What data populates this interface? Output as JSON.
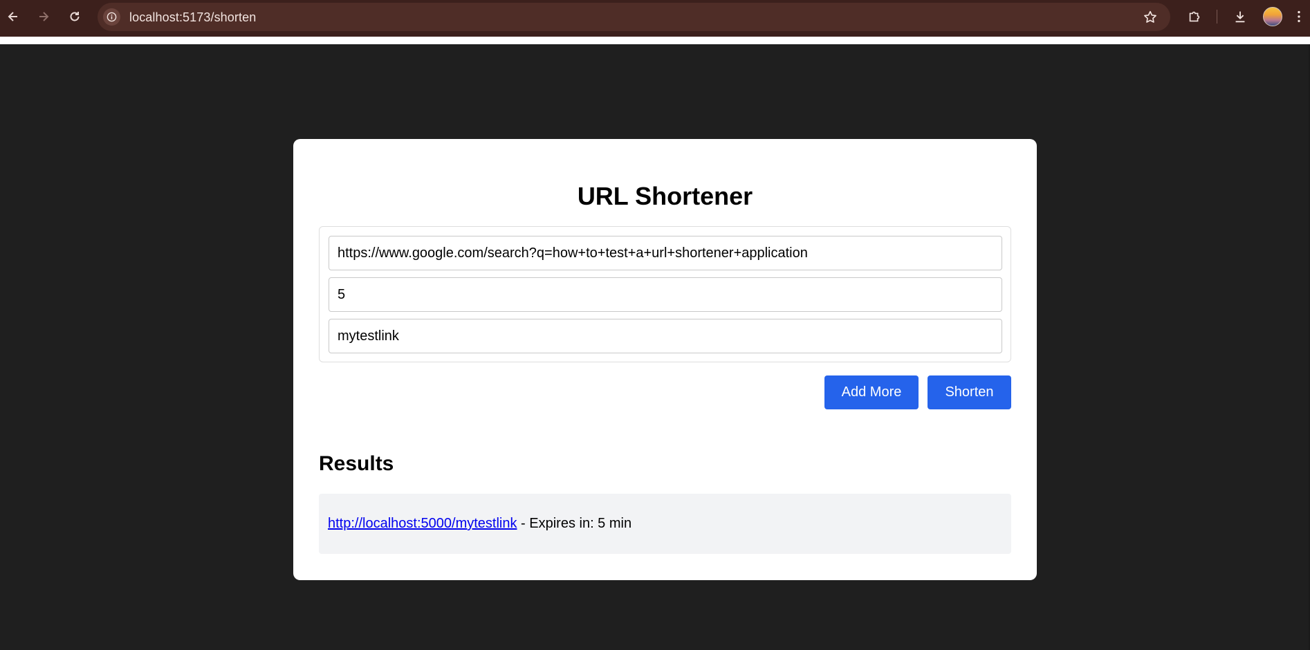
{
  "browser": {
    "url": "localhost:5173/shorten",
    "back_icon": "arrow-left-icon",
    "forward_icon": "arrow-right-icon",
    "reload_icon": "reload-icon",
    "site_info_icon": "info-icon",
    "bookmark_icon": "star-icon",
    "extensions_icon": "puzzle-icon",
    "download_icon": "download-icon",
    "menu_icon": "kebab-menu-icon",
    "chrome_color": "#3c201c"
  },
  "page": {
    "title": "URL Shortener",
    "inputs": {
      "url": "https://www.google.com/search?q=how+to+test+a+url+shortener+application",
      "validity": "5",
      "shortcode": "mytestlink"
    },
    "buttons": {
      "add_more": "Add More",
      "shorten": "Shorten"
    },
    "results": {
      "heading": "Results",
      "items": [
        {
          "short_url": "http://localhost:5000/mytestlink",
          "expiry_text": " - Expires in: 5 min"
        }
      ]
    },
    "accent_color": "#2563eb"
  }
}
